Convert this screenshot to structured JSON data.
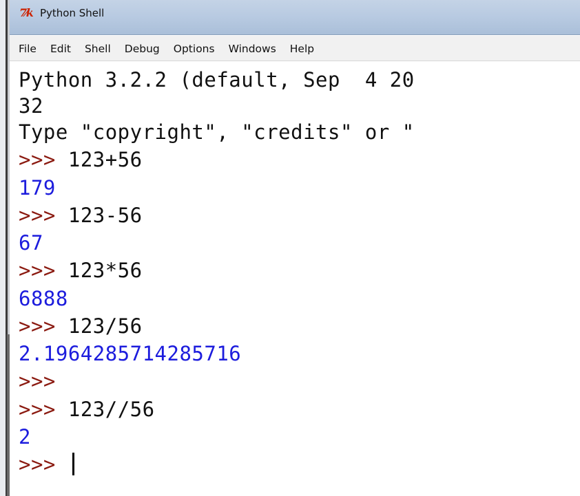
{
  "window": {
    "title": "Python Shell",
    "icon": "tk-icon",
    "icon_text": "7⁄k"
  },
  "menu": [
    "File",
    "Edit",
    "Shell",
    "Debug",
    "Options",
    "Windows",
    "Help"
  ],
  "shell": {
    "banner1": "Python 3.2.2 (default, Sep  4 20",
    "banner2": "32",
    "banner3": "Type \"copyright\", \"credits\" or \"",
    "prompt": ">>>",
    "entries": [
      {
        "cmd": "123+56",
        "result": "179"
      },
      {
        "cmd": "123-56",
        "result": "67"
      },
      {
        "cmd": "123*56",
        "result": "6888"
      },
      {
        "cmd": "123/56",
        "result": "2.1964285714285716"
      },
      {
        "cmd": "",
        "result": null
      },
      {
        "cmd": "123//56",
        "result": "2"
      }
    ],
    "current_input": ""
  },
  "colors": {
    "prompt": "#8b1a10",
    "result": "#1c1cdd",
    "output": "#111111"
  }
}
